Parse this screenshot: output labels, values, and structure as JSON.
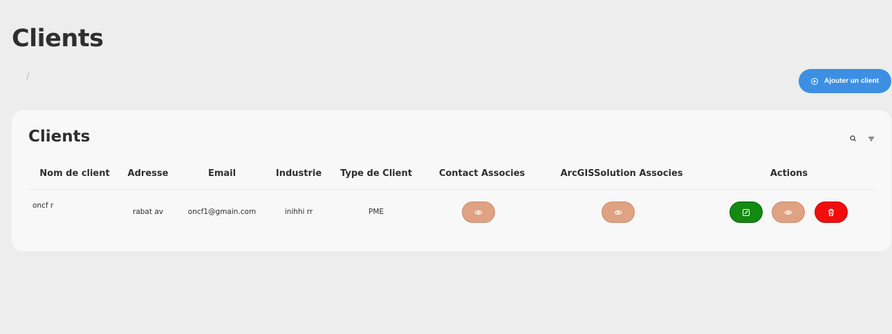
{
  "page": {
    "title": "Clients",
    "breadcrumb": "/"
  },
  "add_button": {
    "label": "Ajouter un client",
    "icon": "plus-circle-icon",
    "color": "#3d8fe3"
  },
  "card": {
    "title": "Clients",
    "toolbar_icons": [
      "search-icon",
      "filter-icon"
    ]
  },
  "table": {
    "columns": [
      "Nom de client",
      "Adresse",
      "Email",
      "Industrie",
      "Type de Client",
      "Contact Associes",
      "ArcGISSolution Associes",
      "Actions"
    ],
    "rows": [
      {
        "nom": "oncf r",
        "adresse": "rabat av",
        "email": "oncf1@gmain.com",
        "industrie": "inihhi rr",
        "type": "PME"
      }
    ]
  },
  "colors": {
    "view_button": "#dfa282",
    "edit_button": "#138a10",
    "delete_button": "#f20d0d"
  }
}
